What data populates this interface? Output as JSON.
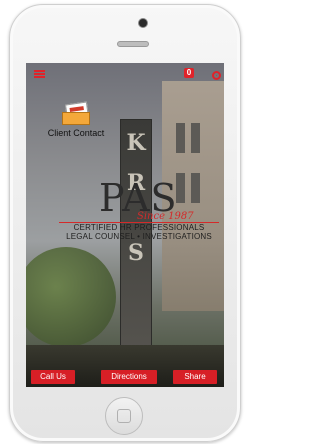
{
  "app": {
    "notification_count": "0"
  },
  "contact": {
    "label": "Client Contact"
  },
  "logo": {
    "brand": "PAS",
    "since": "Since 1987",
    "line1": "CERTIFIED HR PROFESSIONALS",
    "line2": "LEGAL COUNSEL • INVESTIGATIONS"
  },
  "sign_letters": [
    "K",
    "R",
    "S"
  ],
  "actions": {
    "call": "Call Us",
    "directions": "Directions",
    "share": "Share"
  },
  "colors": {
    "accent": "#d71f26"
  },
  "icons": [
    "menu-icon",
    "settings-icon",
    "envelope-icon",
    "camera-icon",
    "home-button-icon"
  ]
}
